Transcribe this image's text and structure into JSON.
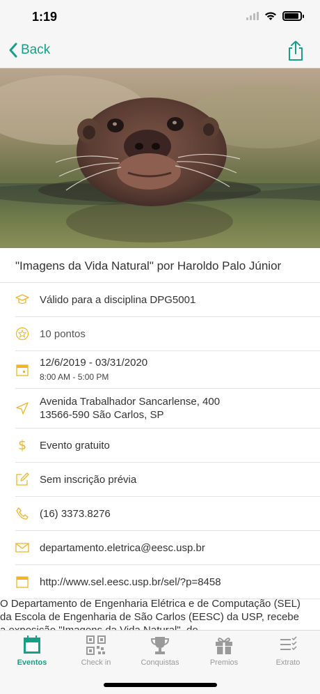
{
  "status": {
    "time": "1:19"
  },
  "nav": {
    "back_label": "Back"
  },
  "event": {
    "title": "\"Imagens da Vida Natural\" por Haroldo Palo Júnior",
    "discipline": "Válido para a disciplina DPG5001",
    "points": "10 pontos",
    "dates": "12/6/2019 - 03/31/2020",
    "hours": "8:00 AM - 5:00 PM",
    "address_line1": "Avenida Trabalhador Sancarlense, 400",
    "address_line2": "13566-590 São Carlos, SP",
    "price": "Evento gratuito",
    "registration": "Sem inscrição prévia",
    "phone": "(16) 3373.8276",
    "email": "departamento.eletrica@eesc.usp.br",
    "url": "http://www.sel.eesc.usp.br/sel/?p=8458",
    "description": "O Departamento de Engenharia Elétrica e de Computação (SEL) da Escola de Engenharia de São Carlos (EESC) da USP, recebe a exposição \"Imagens da Vida Natural\", do"
  },
  "tabs": [
    {
      "label": "Eventos",
      "icon": "calendar-icon",
      "active": true
    },
    {
      "label": "Check in",
      "icon": "qr-code-icon",
      "active": false
    },
    {
      "label": "Conquistas",
      "icon": "trophy-icon",
      "active": false
    },
    {
      "label": "Premios",
      "icon": "gift-icon",
      "active": false
    },
    {
      "label": "Extrato",
      "icon": "list-icon",
      "active": false
    }
  ],
  "colors": {
    "accent": "#17a085",
    "icon_yellow": "#f0b429",
    "tab_inactive": "#999999"
  }
}
